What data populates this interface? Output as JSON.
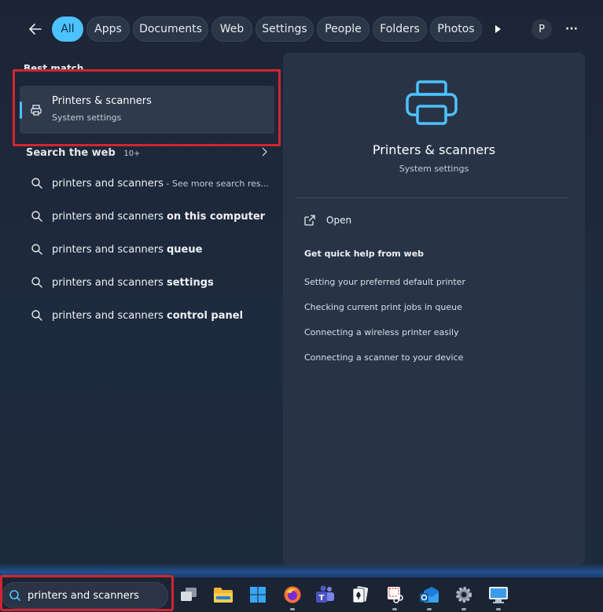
{
  "filters": {
    "items": [
      "All",
      "Apps",
      "Documents",
      "Web",
      "Settings",
      "People",
      "Folders",
      "Photos"
    ],
    "avatar_letter": "P",
    "more_label": "···"
  },
  "best_match": {
    "section_label": "Best match",
    "title": "Printers & scanners",
    "subtitle": "System settings"
  },
  "search_web": {
    "section_label": "Search the web",
    "count": "10+",
    "results": [
      {
        "prefix": "printers and scanners",
        "bold": "",
        "suffix": " - See more search res..."
      },
      {
        "prefix": "printers and scanners ",
        "bold": "on this computer",
        "suffix": ""
      },
      {
        "prefix": "printers and scanners ",
        "bold": "queue",
        "suffix": ""
      },
      {
        "prefix": "printers and scanners ",
        "bold": "settings",
        "suffix": ""
      },
      {
        "prefix": "printers and scanners ",
        "bold": "control panel",
        "suffix": ""
      }
    ]
  },
  "detail": {
    "title": "Printers & scanners",
    "subtitle": "System settings",
    "open_label": "Open",
    "help_heading": "Get quick help from web",
    "help_links": [
      "Setting your preferred default printer",
      "Checking current print jobs in queue",
      "Connecting a wireless printer easily",
      "Connecting a scanner to your device"
    ]
  },
  "taskbar": {
    "search_value": "printers and scanners",
    "icons": [
      "task-view-icon",
      "file-explorer-icon",
      "start-icon",
      "firefox-icon",
      "teams-icon",
      "solitaire-icon",
      "snipping-tool-icon",
      "outlook-icon",
      "settings-gear-icon",
      "remote-desktop-icon"
    ]
  },
  "colors": {
    "accent": "#4cc2ff",
    "highlight": "#d0262f",
    "panel": "#283446"
  }
}
